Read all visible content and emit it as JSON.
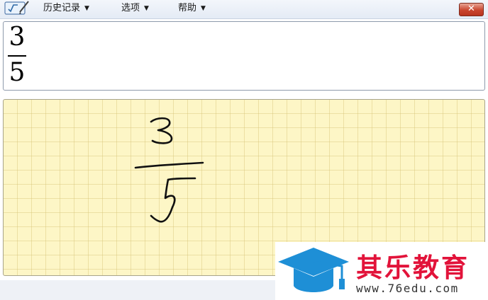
{
  "menu": {
    "items": [
      {
        "label": "历史记录"
      },
      {
        "label": "选项"
      },
      {
        "label": "帮助"
      }
    ]
  },
  "window": {
    "close_label": "✕"
  },
  "preview": {
    "numerator": "3",
    "denominator": "5"
  },
  "watermark": {
    "name": "其乐教育",
    "url": "www.76edu.com"
  },
  "colors": {
    "accent_red": "#e2133a",
    "cap_blue": "#1e8fd6",
    "grid_bg": "#fdf6c6",
    "close_red": "#c9452e"
  },
  "icons": {
    "app": "math-input-icon",
    "dropdown": "chevron-down-icon",
    "close": "close-icon",
    "cap": "graduation-cap-icon"
  }
}
